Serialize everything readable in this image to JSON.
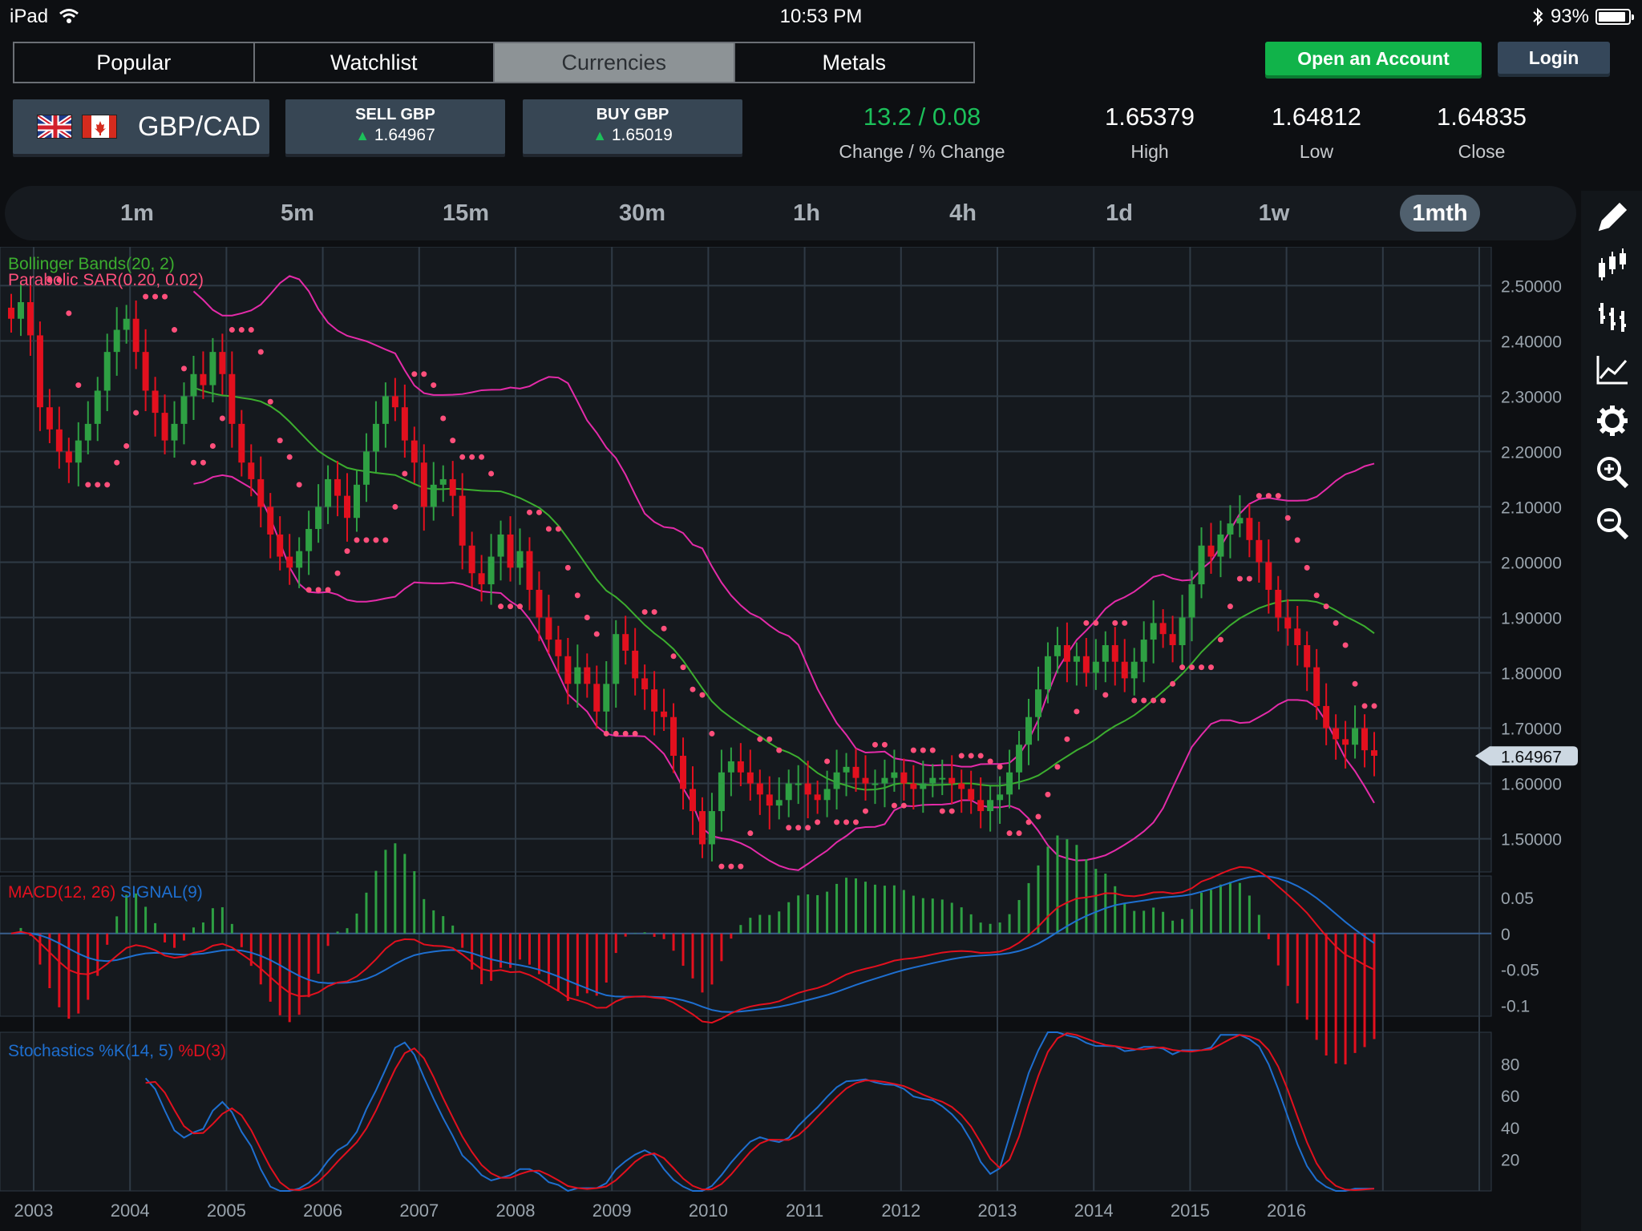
{
  "status_bar": {
    "device": "iPad",
    "time": "10:53 PM",
    "battery": "93%"
  },
  "top_tabs": [
    "Popular",
    "Watchlist",
    "Currencies",
    "Metals"
  ],
  "active_tab": "Currencies",
  "buttons": {
    "open_account": "Open an Account",
    "login": "Login"
  },
  "quote": {
    "pair": "GBP/CAD",
    "sell": {
      "label": "SELL GBP",
      "value": "1.64967"
    },
    "buy": {
      "label": "BUY GBP",
      "value": "1.65019"
    },
    "change": "13.2 / 0.08",
    "change_label": "Change / % Change",
    "high": "1.65379",
    "high_label": "High",
    "low": "1.64812",
    "low_label": "Low",
    "close": "1.64835",
    "close_label": "Close"
  },
  "timeframes": [
    "1m",
    "5m",
    "15m",
    "30m",
    "1h",
    "4h",
    "1d",
    "1w",
    "1mth"
  ],
  "active_timeframe": "1mth",
  "toolbar_icons": [
    "pencil-icon",
    "candlestick-icon",
    "bar-chart-icon",
    "line-chart-icon",
    "gear-icon",
    "zoom-in-icon",
    "zoom-out-icon"
  ],
  "colors": {
    "up": "#2ea043",
    "down": "#e3101e",
    "sar": "#ff4f7b",
    "bb_outer": "#e42ba9",
    "bb_mid": "#3cae2f",
    "macd": "#e3101e",
    "signal": "#1e6fd0",
    "accent_green": "#11b34a"
  },
  "chart_data": {
    "type": "candlestick",
    "years": [
      "2003",
      "2004",
      "2005",
      "2006",
      "2007",
      "2008",
      "2009",
      "2010",
      "2011",
      "2012",
      "2013",
      "2014",
      "2015",
      "2016"
    ],
    "price_axis": [
      "2.50000",
      "2.40000",
      "2.30000",
      "2.20000",
      "2.10000",
      "2.00000",
      "1.90000",
      "1.80000",
      "1.70000",
      "1.60000",
      "1.50000"
    ],
    "price_range": [
      1.44,
      2.57
    ],
    "current_price": "1.64967",
    "indicator_labels": {
      "bollinger": "Bollinger Bands(20, 2)",
      "sar": "Parabolic SAR(0.20, 0.02)",
      "macd": "MACD(12, 26)",
      "signal": "SIGNAL(9)",
      "stoch_k": "Stochastics %K(14, 5)",
      "stoch_d": "%D(3)"
    },
    "macd_axis": [
      "0.05",
      "0",
      "-0.05",
      "-0.1"
    ],
    "macd_range": [
      -0.115,
      0.08
    ],
    "stoch_axis": [
      "80",
      "60",
      "40",
      "20"
    ],
    "close_series": [
      2.44,
      2.47,
      2.41,
      2.28,
      2.24,
      2.2,
      2.18,
      2.22,
      2.25,
      2.31,
      2.38,
      2.42,
      2.44,
      2.38,
      2.31,
      2.27,
      2.22,
      2.25,
      2.3,
      2.34,
      2.32,
      2.38,
      2.34,
      2.25,
      2.18,
      2.15,
      2.1,
      2.05,
      2.01,
      1.99,
      2.02,
      2.06,
      2.1,
      2.15,
      2.12,
      2.08,
      2.14,
      2.2,
      2.25,
      2.3,
      2.28,
      2.22,
      2.18,
      2.1,
      2.14,
      2.15,
      2.12,
      2.03,
      1.98,
      1.96,
      2.01,
      2.05,
      1.99,
      2.02,
      1.95,
      1.9,
      1.86,
      1.83,
      1.78,
      1.81,
      1.78,
      1.73,
      1.78,
      1.87,
      1.84,
      1.79,
      1.77,
      1.73,
      1.72,
      1.65,
      1.59,
      1.55,
      1.49,
      1.55,
      1.62,
      1.64,
      1.62,
      1.6,
      1.58,
      1.56,
      1.57,
      1.6,
      1.6,
      1.58,
      1.57,
      1.59,
      1.62,
      1.63,
      1.61,
      1.6,
      1.6,
      1.61,
      1.62,
      1.6,
      1.59,
      1.6,
      1.61,
      1.61,
      1.6,
      1.59,
      1.57,
      1.55,
      1.57,
      1.58,
      1.62,
      1.67,
      1.72,
      1.77,
      1.83,
      1.85,
      1.82,
      1.83,
      1.8,
      1.82,
      1.85,
      1.82,
      1.79,
      1.82,
      1.86,
      1.89,
      1.87,
      1.85,
      1.9,
      1.96,
      2.03,
      2.01,
      2.05,
      2.07,
      2.08,
      2.04,
      2.0,
      1.95,
      1.9,
      1.88,
      1.85,
      1.81,
      1.74,
      1.7,
      1.68,
      1.67,
      1.7,
      1.66,
      1.65
    ]
  }
}
